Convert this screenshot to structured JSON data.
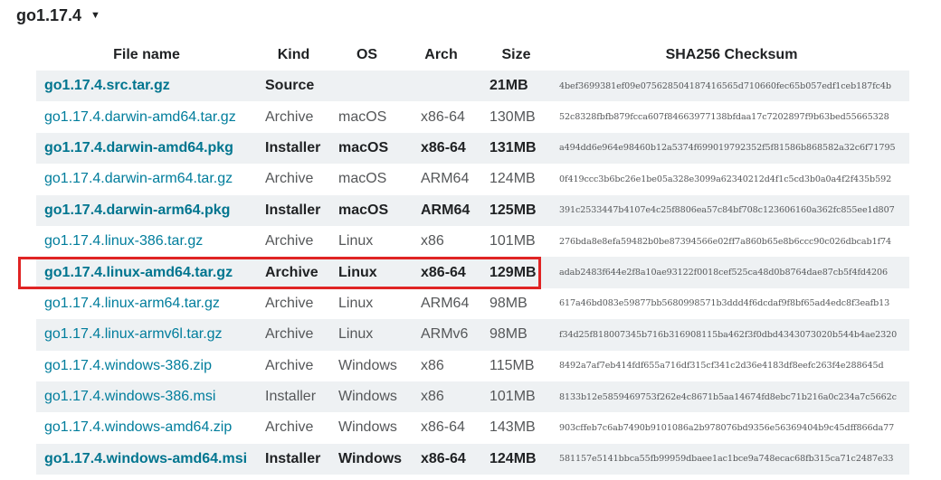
{
  "version": {
    "title": "go1.17.4",
    "toggle_icon": "▼"
  },
  "table": {
    "headers": [
      "File name",
      "Kind",
      "OS",
      "Arch",
      "Size",
      "SHA256 Checksum"
    ],
    "rows": [
      {
        "file": "go1.17.4.src.tar.gz",
        "kind": "Source",
        "os": "",
        "arch": "",
        "size": "21MB",
        "checksum": "4bef3699381ef09e075628504187416565d710660fec65b057edf1ceb187fc4b",
        "highlight": true
      },
      {
        "file": "go1.17.4.darwin-amd64.tar.gz",
        "kind": "Archive",
        "os": "macOS",
        "arch": "x86-64",
        "size": "130MB",
        "checksum": "52c8328fbfb879fcca607f84663977138bfdaa17c7202897f9b63bed55665328",
        "highlight": false
      },
      {
        "file": "go1.17.4.darwin-amd64.pkg",
        "kind": "Installer",
        "os": "macOS",
        "arch": "x86-64",
        "size": "131MB",
        "checksum": "a494dd6e964e98460b12a5374f699019792352f5f81586b868582a32c6f71795",
        "highlight": true
      },
      {
        "file": "go1.17.4.darwin-arm64.tar.gz",
        "kind": "Archive",
        "os": "macOS",
        "arch": "ARM64",
        "size": "124MB",
        "checksum": "0f419ccc3b6bc26e1be05a328e3099a62340212d4f1c5cd3b0a0a4f2f435b592",
        "highlight": false
      },
      {
        "file": "go1.17.4.darwin-arm64.pkg",
        "kind": "Installer",
        "os": "macOS",
        "arch": "ARM64",
        "size": "125MB",
        "checksum": "391c2533447b4107e4c25f8806ea57c84bf708c123606160a362fc855ee1d807",
        "highlight": true
      },
      {
        "file": "go1.17.4.linux-386.tar.gz",
        "kind": "Archive",
        "os": "Linux",
        "arch": "x86",
        "size": "101MB",
        "checksum": "276bda8e8efa59482b0be87394566e02ff7a860b65e8b6ccc90c026dbcab1f74",
        "highlight": false
      },
      {
        "file": "go1.17.4.linux-amd64.tar.gz",
        "kind": "Archive",
        "os": "Linux",
        "arch": "x86-64",
        "size": "129MB",
        "checksum": "adab2483f644e2f8a10ae93122f0018cef525ca48d0b8764dae87cb5f4fd4206",
        "highlight": true
      },
      {
        "file": "go1.17.4.linux-arm64.tar.gz",
        "kind": "Archive",
        "os": "Linux",
        "arch": "ARM64",
        "size": "98MB",
        "checksum": "617a46bd083e59877bb5680998571b3ddd4f6dcdaf9f8bf65ad4edc8f3eafb13",
        "highlight": false
      },
      {
        "file": "go1.17.4.linux-armv6l.tar.gz",
        "kind": "Archive",
        "os": "Linux",
        "arch": "ARMv6",
        "size": "98MB",
        "checksum": "f34d25f818007345b716b316908115ba462f3f0dbd4343073020b544b4ae2320",
        "highlight": false
      },
      {
        "file": "go1.17.4.windows-386.zip",
        "kind": "Archive",
        "os": "Windows",
        "arch": "x86",
        "size": "115MB",
        "checksum": "8492a7af7eb414fdf655a716df315cf341c2d36e4183df8eefc263f4e288645d",
        "highlight": false
      },
      {
        "file": "go1.17.4.windows-386.msi",
        "kind": "Installer",
        "os": "Windows",
        "arch": "x86",
        "size": "101MB",
        "checksum": "8133b12e5859469753f262e4c8671b5aa14674fd8ebc71b216a0c234a7c5662c",
        "highlight": false
      },
      {
        "file": "go1.17.4.windows-amd64.zip",
        "kind": "Archive",
        "os": "Windows",
        "arch": "x86-64",
        "size": "143MB",
        "checksum": "903cffeb7c6ab7490b9101086a2b978076bd9356e56369404b9c45dff866da77",
        "highlight": false
      },
      {
        "file": "go1.17.4.windows-amd64.msi",
        "kind": "Installer",
        "os": "Windows",
        "arch": "x86-64",
        "size": "124MB",
        "checksum": "581157e5141bbca55fb99959dbaee1ac1bce9a748ecac68fb315ca71c2487e33",
        "highlight": true
      }
    ]
  },
  "selection": {
    "outline_color": "#e02424",
    "selected_file": "go1.17.4.linux-amd64.tar.gz"
  },
  "colors": {
    "link": "#007d9c",
    "row_stripe": "#eef1f3",
    "text": "#555759"
  }
}
